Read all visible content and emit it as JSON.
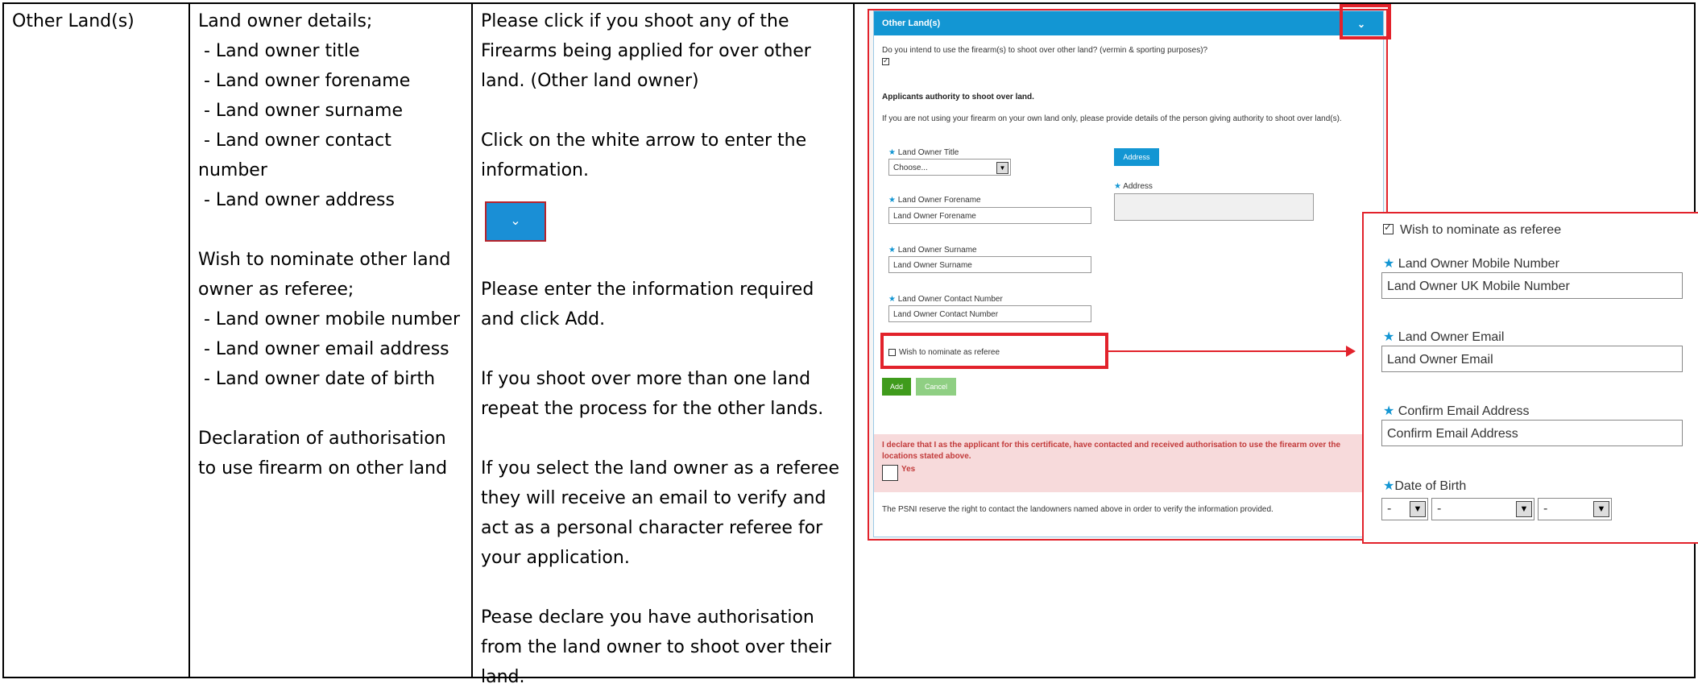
{
  "col1": {
    "title": "Other Land(s)"
  },
  "col2": {
    "lines": [
      "Land owner details;",
      " - Land owner title",
      " - Land owner forename",
      " - Land owner surname",
      " - Land owner contact",
      "number",
      " - Land owner address",
      "",
      "Wish to nominate other land",
      "owner as referee;",
      " - Land owner mobile number",
      " - Land owner email address",
      " - Land owner date of birth",
      "",
      "Declaration of authorisation",
      "to use firearm on other land"
    ]
  },
  "col3": {
    "p1": [
      "Please click if you shoot any of the",
      "Firearms being applied for over other",
      "land. (Other land owner)"
    ],
    "p2": [
      "Click on the white arrow to enter the",
      "information."
    ],
    "p3": [
      "Please enter the information required",
      "and click Add."
    ],
    "p4": [
      "If you shoot over more than one land",
      "repeat the process for the other lands."
    ],
    "p5": [
      "If you select the land owner as a referee",
      "they will receive an email to verify and",
      "act as a personal character referee for",
      "your application."
    ],
    "p6": [
      "Pease declare you have authorisation",
      "from the land owner to shoot over their",
      "land."
    ]
  },
  "form": {
    "header": "Other Land(s)",
    "question": "Do you intend to use the firearm(s) to shoot over other land? (vermin & sporting purposes)?",
    "authority_title": "Applicants authority to shoot over land.",
    "authority_text": "If you are not using your firearm on your own land only, please provide details of the person giving authority to shoot over land(s).",
    "title_label": "Land Owner Title",
    "title_value": "Choose...",
    "address_button": "Address",
    "address_label": "Address",
    "forename_label": "Land Owner Forename",
    "forename_value": "Land Owner Forename",
    "surname_label": "Land Owner Surname",
    "surname_value": "Land Owner Surname",
    "contact_label": "Land Owner Contact Number",
    "contact_value": "Land Owner Contact Number",
    "referee_label": "Wish to nominate as referee",
    "add_button": "Add",
    "cancel_button": "Cancel",
    "declaration": "I declare that I as the applicant for this certificate, have contacted and received authorisation to use the firearm over the locations stated above.",
    "yes_label": "Yes",
    "psni_note": "The PSNI reserve the right to contact the landowners named above in order to verify the information provided."
  },
  "zoom": {
    "referee_label": "Wish to nominate as referee",
    "mobile_label": "Land Owner Mobile Number",
    "mobile_value": "Land Owner UK Mobile Number",
    "email_label": "Land Owner Email",
    "email_value": "Land Owner Email",
    "confirm_label": "Confirm Email Address",
    "confirm_value": "Confirm Email Address",
    "dob_label": "Date of Birth",
    "dob_day": "-",
    "dob_month": "-",
    "dob_year": "-"
  },
  "colors": {
    "accent": "#1396d3",
    "highlight": "#e2222b",
    "add": "#3f9b1c"
  }
}
